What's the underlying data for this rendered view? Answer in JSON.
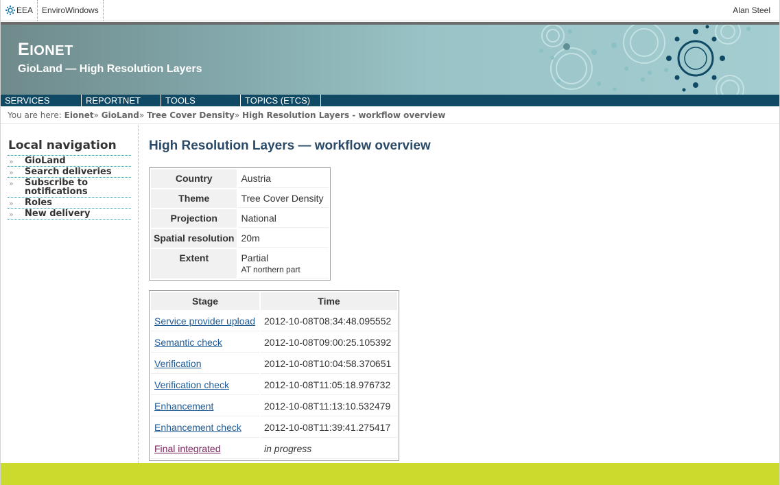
{
  "topbar": {
    "eea": "EEA",
    "envirowindows": "EnviroWindows",
    "user": "Alan Steel"
  },
  "banner": {
    "brand_first": "E",
    "brand_rest": "IONET",
    "subtitle": "GioLand — High Resolution Layers"
  },
  "nav": [
    "SERVICES",
    "REPORTNET",
    "TOOLS",
    "TOPICS (ETCS)"
  ],
  "breadcrumb": {
    "prefix": "You are here: ",
    "items": [
      "Eionet",
      "GioLand",
      "Tree Cover Density",
      "High Resolution Layers - workflow overview"
    ],
    "separator": "»"
  },
  "sidebar": {
    "title": "Local navigation",
    "items": [
      "GioLand",
      "Search deliveries",
      "Subscribe to notifications",
      "Roles",
      "New delivery"
    ]
  },
  "main": {
    "title": "High Resolution Layers — workflow overview",
    "properties": [
      {
        "label": "Country",
        "value": "Austria"
      },
      {
        "label": "Theme",
        "value": "Tree Cover Density"
      },
      {
        "label": "Projection",
        "value": "National"
      },
      {
        "label": "Spatial resolution",
        "value": "20m"
      },
      {
        "label": "Extent",
        "value": "Partial",
        "note": "AT northern part"
      }
    ],
    "stages_headers": [
      "Stage",
      "Time"
    ],
    "stages": [
      {
        "stage": "Service provider upload",
        "time": "2012-10-08T08:34:48.095552"
      },
      {
        "stage": "Semantic check",
        "time": "2012-10-08T09:00:25.105392"
      },
      {
        "stage": "Verification",
        "time": "2012-10-08T10:04:58.370651"
      },
      {
        "stage": "Verification check",
        "time": "2012-10-08T11:05:18.976732"
      },
      {
        "stage": "Enhancement",
        "time": "2012-10-08T11:13:10.532479"
      },
      {
        "stage": "Enhancement check",
        "time": "2012-10-08T11:39:41.275417"
      },
      {
        "stage": "Final integrated",
        "time": "in progress"
      }
    ]
  },
  "colors": {
    "navbar": "#0f4964",
    "footer": "#cbda2c",
    "link": "#1e5a96",
    "visited_link": "#7a1f5b"
  }
}
